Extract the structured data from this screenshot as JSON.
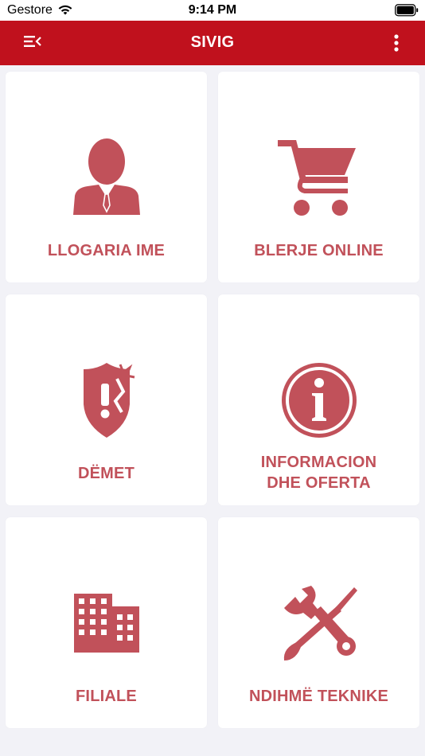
{
  "status_bar": {
    "carrier": "Gestore",
    "time": "9:14 PM"
  },
  "nav": {
    "title": "SIVIG",
    "menu_icon": "menu-collapse-icon",
    "more_icon": "more-vertical-icon"
  },
  "tiles": [
    {
      "label": "LLOGARIA IME",
      "icon": "user-icon"
    },
    {
      "label": "BLERJE ONLINE",
      "icon": "cart-icon"
    },
    {
      "label": "DËMET",
      "icon": "damage-shield-icon"
    },
    {
      "label": "INFORMACION",
      "label2": "DHE OFERTA",
      "icon": "info-icon"
    },
    {
      "label": "FILIALE",
      "icon": "building-icon"
    },
    {
      "label": "NDIHMË TEKNIKE",
      "icon": "tools-icon"
    }
  ],
  "colors": {
    "brand_red": "#c0111d",
    "tile_icon": "#c1515a",
    "background": "#f2f2f7"
  }
}
